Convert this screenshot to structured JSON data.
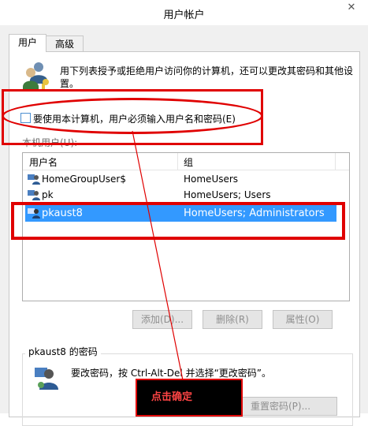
{
  "window": {
    "title": "用户帐户",
    "close_glyph": "✕"
  },
  "tabs": [
    {
      "label": "用户",
      "selected": true
    },
    {
      "label": "高级",
      "selected": false
    }
  ],
  "description": "用下列表授予或拒绝用户访问你的计算机，还可以更改其密码和其他设置。",
  "require_login_checkbox": {
    "label": "要使用本计算机，用户必须输入用户名和密码(E)",
    "checked": false
  },
  "local_users_label": "本机用户(U):",
  "table": {
    "columns": [
      "用户名",
      "组"
    ],
    "rows": [
      {
        "name": "HomeGroupUser$",
        "group": "HomeUsers",
        "selected": false
      },
      {
        "name": "pk",
        "group": "HomeUsers; Users",
        "selected": false
      },
      {
        "name": "pkaust8",
        "group": "HomeUsers; Administrators",
        "selected": true
      }
    ]
  },
  "buttons": {
    "add": "添加(D)...",
    "remove": "删除(R)",
    "properties": "属性(O)",
    "reset_password": "重置密码(P)..."
  },
  "password_group": {
    "title": "pkaust8 的密码",
    "text": "要改密码，按 Ctrl-Alt-Del 并选择“更改密码”。"
  },
  "annotation": {
    "callout": "点击确定",
    "color": "#e00000"
  },
  "icons": {
    "users": "users-icon",
    "user_row": "user-icon",
    "password_user": "user-key-icon"
  }
}
